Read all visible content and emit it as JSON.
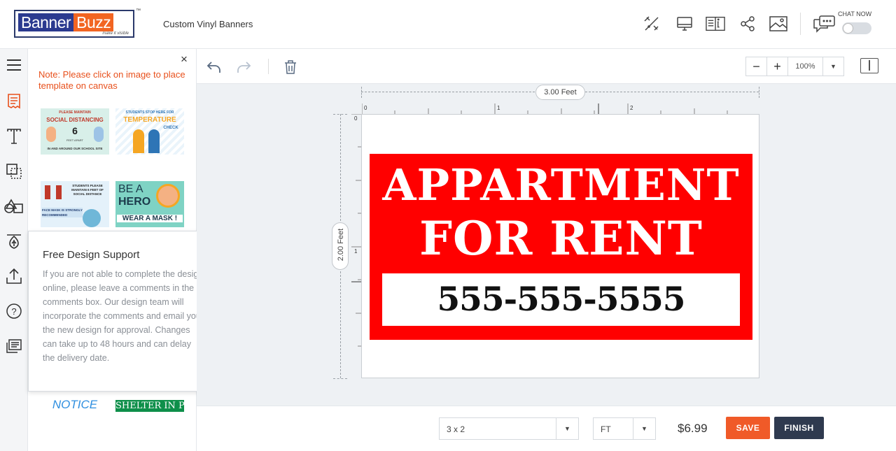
{
  "header": {
    "logo_banner": "Banner",
    "logo_buzz": "Buzz",
    "logo_tagline": "make it visible",
    "logo_tm": "™",
    "page_title": "Custom Vinyl Banners",
    "icons": [
      "magic-tools-icon",
      "monitor-preview-icon",
      "info-book-icon",
      "share-icon",
      "image-icon",
      "chat-icon"
    ],
    "chat_label": "CHAT NOW"
  },
  "rail": {
    "items": [
      "menu-icon",
      "templates-icon",
      "text-icon",
      "shapes-icon",
      "clipart-icon",
      "background-icon",
      "upload-icon",
      "help-icon",
      "comments-icon"
    ]
  },
  "panel": {
    "close": "×",
    "note": "Note: Please click on image to place template on canvas",
    "thumbs": [
      {
        "l1": "PLEASE MAINTAIN",
        "l2": "SOCIAL DISTANCING",
        "l3": "6",
        "l4": "FEET APART",
        "l5": "IN AND AROUND OUR SCHOOL SITE"
      },
      {
        "l1": "STUDENTS STOP HERE FOR",
        "l2": "TEMPERATURE",
        "l3": "CHECK"
      },
      {
        "l1": "STUDENTS PLEASE MAINTAIN 6 FEET OF SOCIAL DISTANCE",
        "l2": "FACE MASK IS STRONGLY RECOMMENDED"
      },
      {
        "l1": "BE A",
        "l2": "HERO",
        "l3": "WEAR A MASK !"
      }
    ],
    "bottom_thumb_notice": "NOTICE",
    "bottom_thumb_shelter": "SHELTER IN PLACE"
  },
  "popover": {
    "close": "×",
    "title": "Free Design Support",
    "body": "If you are not able to complete the design online, please leave a comments in the comments box. Our design team will incorporate the comments and email you the new design for approval. Changes can take up to 48 hours and can delay the delivery date."
  },
  "toolbar": {
    "zoom_minus": "−",
    "zoom_plus": "+",
    "zoom_value": "100%",
    "zoom_arrow": "▼"
  },
  "canvas": {
    "width_label": "3.00 Feet",
    "height_label": "2.00 Feet",
    "ruler_top": [
      "0",
      "1",
      "2"
    ],
    "ruler_left": [
      "0",
      "1"
    ],
    "banner_bg": "#ff0000",
    "line1": "APPARTMENT",
    "line2": "FOR RENT",
    "phone": "555-555-5555"
  },
  "footer": {
    "size_value": "3 x 2",
    "unit_value": "FT",
    "select_arrow": "▼",
    "price": "$6.99",
    "save_label": "SAVE",
    "finish_label": "FINISH",
    "save_color": "#f05a28",
    "finish_color": "#2f3a4f"
  }
}
